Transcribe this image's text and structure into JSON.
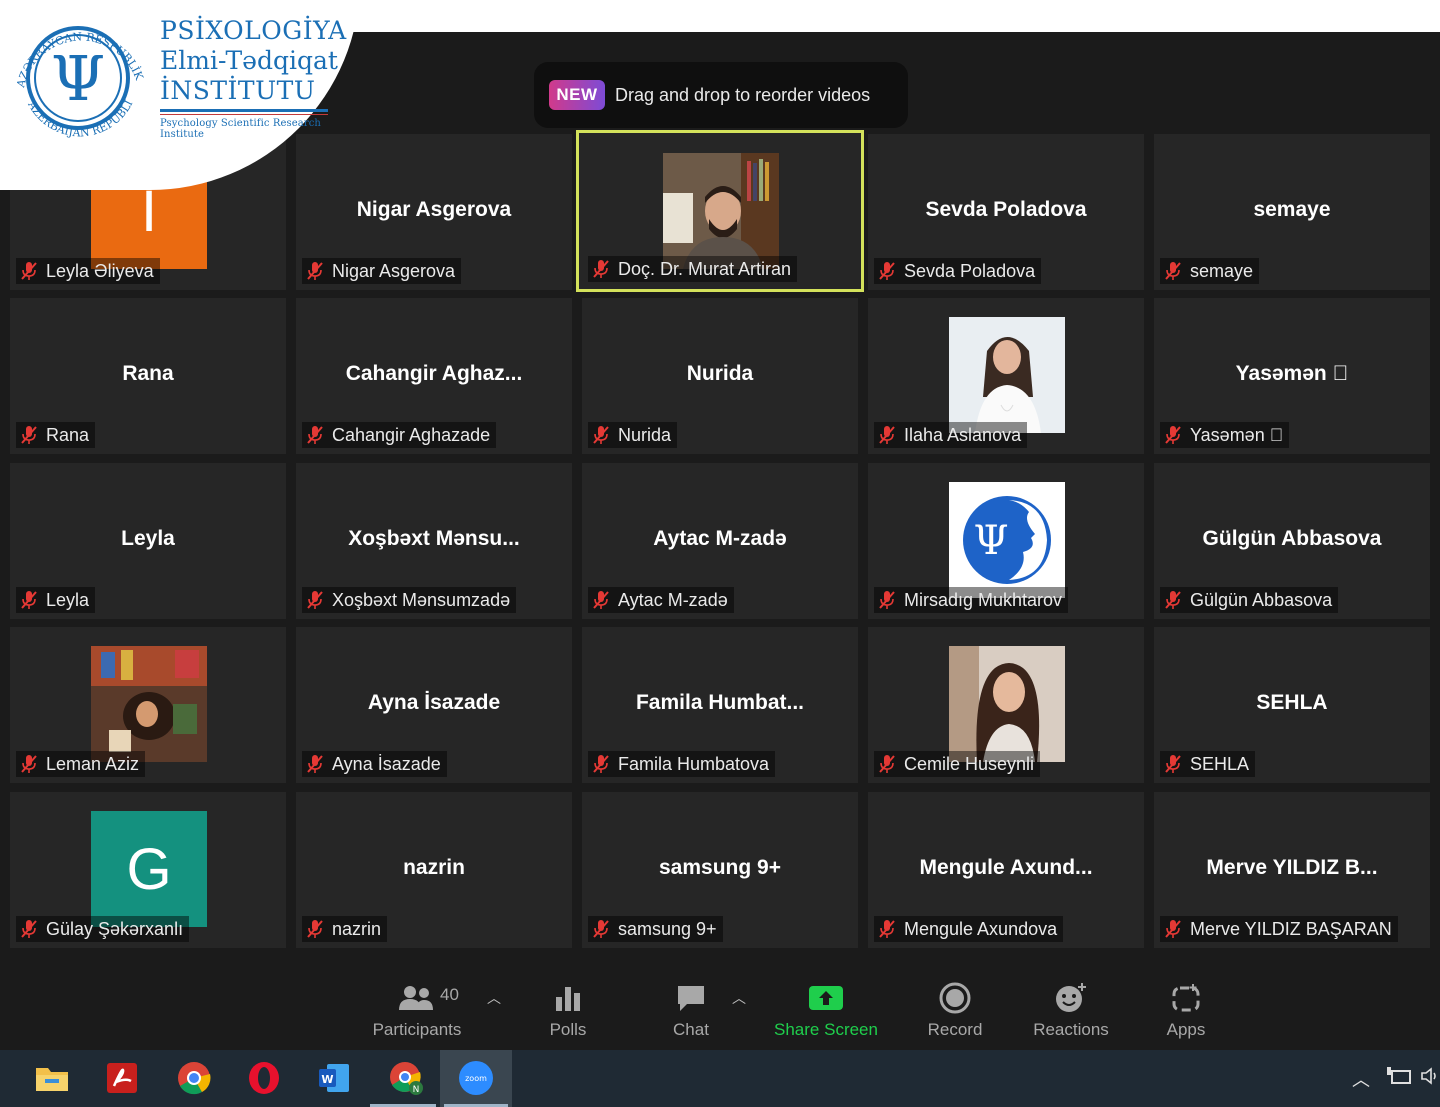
{
  "logo": {
    "line1": "PSİXOLOGİYA",
    "line2": "Elmi-Tədqiqat",
    "line3": "İNSTİTUTU",
    "subtitle": "Psychology Scientific Research Institute",
    "ring_top": "AZƏRBAYCAN RESPUBLİKASI",
    "ring_bottom": "AZERBAIJAN REPUBLIC",
    "symbol": "Ψ"
  },
  "banner": {
    "badge": "NEW",
    "text": "Drag and drop to reorder videos"
  },
  "tiles": [
    {
      "display": "",
      "label": "Leyla Əliyeva",
      "avatar_letter": "I",
      "avatar_color": "#ea6a11"
    },
    {
      "display": "Nigar Asgerova",
      "label": "Nigar Asgerova"
    },
    {
      "display": "",
      "label": "Doç. Dr. Murat Artiran",
      "active": true
    },
    {
      "display": "Sevda Poladova",
      "label": "Sevda Poladova"
    },
    {
      "display": "semaye",
      "label": "semaye"
    },
    {
      "display": "Rana",
      "label": "Rana"
    },
    {
      "display": "Cahangir  Aghaz...",
      "label": "Cahangir Aghazade"
    },
    {
      "display": "Nurida",
      "label": "Nurida"
    },
    {
      "display": "",
      "label": "Ilaha Aslanova"
    },
    {
      "display": "Yasəmən 󰀀",
      "label": "Yasəmən 󰀀"
    },
    {
      "display": "Leyla",
      "label": "Leyla"
    },
    {
      "display": "Xoşbəxt  Mənsu...",
      "label": "Xoşbəxt Mənsumzadə"
    },
    {
      "display": "Aytac M-zadə",
      "label": "Aytac M-zadə"
    },
    {
      "display": "",
      "label": "Mirsadıg Mukhtarov"
    },
    {
      "display": "Gülgün Abbasova",
      "label": "Gülgün Abbasova"
    },
    {
      "display": "",
      "label": "Leman Aziz"
    },
    {
      "display": "Ayna İsazade",
      "label": "Ayna İsazade"
    },
    {
      "display": "Famila  Humbat...",
      "label": "Famila Humbatova"
    },
    {
      "display": "",
      "label": "Cemile Huseynli"
    },
    {
      "display": "SEHLA",
      "label": "SEHLA"
    },
    {
      "display": "",
      "label": "Gülay Şəkərxanlı",
      "avatar_letter": "G",
      "avatar_color": "#14917f"
    },
    {
      "display": "nazrin",
      "label": "nazrin"
    },
    {
      "display": "samsung 9+",
      "label": "samsung 9+"
    },
    {
      "display": "Mengule  Axund...",
      "label": "Mengule Axundova"
    },
    {
      "display": "Merve YILDIZ B...",
      "label": "Merve YILDIZ BAŞARAN"
    }
  ],
  "toolbar": {
    "participants_label": "Participants",
    "participants_count": "40",
    "polls_label": "Polls",
    "chat_label": "Chat",
    "share_label": "Share Screen",
    "record_label": "Record",
    "reactions_label": "Reactions",
    "apps_label": "Apps",
    "share_color": "#1fce4c"
  },
  "taskbar": {
    "apps": [
      "file-explorer",
      "acrobat-reader",
      "chrome",
      "opera",
      "word",
      "chrome-profile",
      "zoom"
    ],
    "zoom_label": "zoom"
  }
}
